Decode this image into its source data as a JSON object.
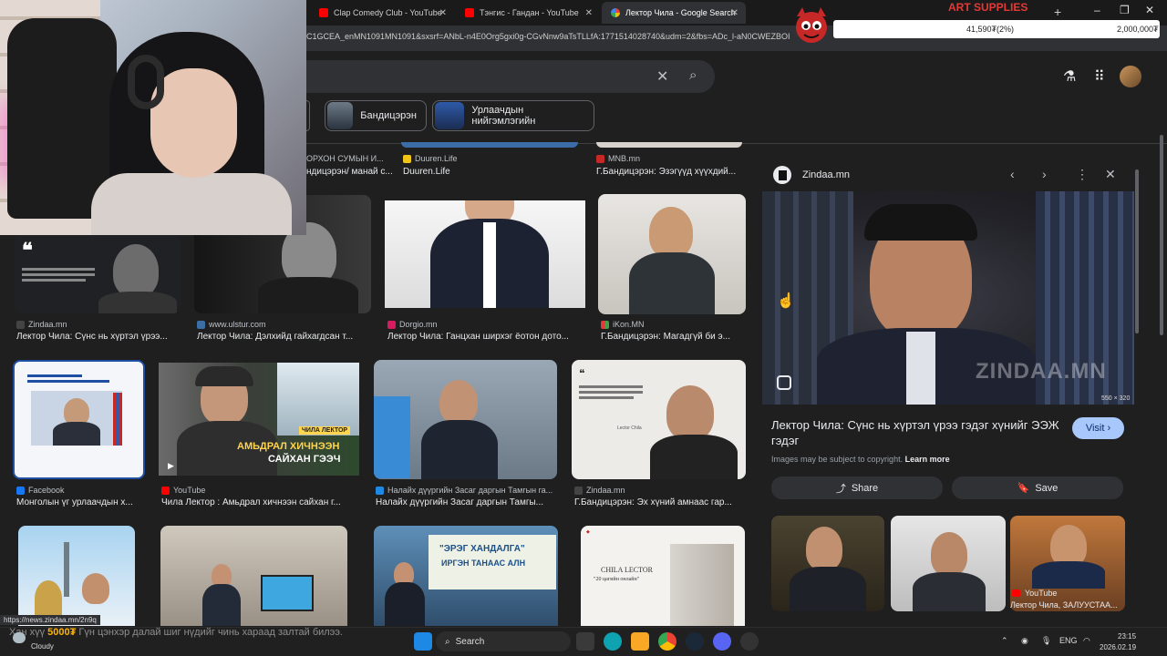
{
  "browser": {
    "tabs": [
      {
        "label": "Clap Comedy Club - YouTube",
        "icon": "youtube-icon",
        "active": false
      },
      {
        "label": "Тэнгис - Гандан - YouTube",
        "icon": "youtube-icon",
        "active": false
      },
      {
        "label": "Лектор Чила - Google Search",
        "icon": "google-icon",
        "active": true
      }
    ],
    "url": "C1GCEA_enMN1091MN1091&sxsrf=ANbL-n4E0Org5gxi0g-CGvNnw9aTsTLLfA:1771514028740&udm=2&fbs=ADc_l-aN0CWEZBOI"
  },
  "overlay": {
    "art_title": "ART SUPPLIES",
    "art_left": "41,590₮(2%)",
    "art_right": "2,000,000₮",
    "ticker_amount": "5000₮",
    "ticker_prefix": "Хан хүү",
    "ticker_text": "Гүн цэнхэр далай шиг нүдийг чинь хараад залтай билээ."
  },
  "search": {
    "chips": [
      {
        "label": "Бандицэрэн"
      },
      {
        "label": "Урлаачдын нийгэмлэгийн"
      }
    ]
  },
  "results": {
    "row0": [
      {
        "source": "ОРХОН СУМЫН И...",
        "title": "ндицэрэн/ манай с..."
      },
      {
        "source": "Duuren.Life",
        "title": "Duuren.Life"
      },
      {
        "source": "MNB.mn",
        "title": "Г.Бандицэрэн: Эзэгүүд хүүхдий..."
      }
    ],
    "row1": [
      {
        "source": "Zindaa.mn",
        "title": "Лектор Чила: Сүнс нь хүртэл үрээ..."
      },
      {
        "source": "www.ulstur.com",
        "title": "Лектор Чила: Дэлхийд гайхагдсан т..."
      },
      {
        "source": "Dorgio.mn",
        "title": "Лектор Чила: Ганцхан ширхэг ёотон дото..."
      },
      {
        "source": "iKon.MN",
        "title": "Г.Бандицэрэн: Магадгүй би э..."
      }
    ],
    "row2": [
      {
        "source": "Facebook",
        "title": "Монголын үг урлаачдын х..."
      },
      {
        "source": "YouTube",
        "title": "Чила Лектор : Амьдрал хичнээн сайхан г..."
      },
      {
        "source": "Налайх дүүргийн Засаг даргын Тамгын га...",
        "title": "Налайх дүүргийн Засаг даргын Тамгы..."
      },
      {
        "source": "Zindaa.mn",
        "title": "Г.Бандицэрэн: Эх хүний амнаас гар..."
      }
    ],
    "youtube_overlay": {
      "tag": "ЧИЛА ЛЕКТОР",
      "line1": "АМЬДРАЛ ХИЧНЭЭН",
      "line2": "САЙХАН ГЭЭЧ"
    },
    "banner": {
      "line1": "\"ЭРЭГ ХАНДАЛГА\"",
      "line2": "ИРГЭН ТАНААС АЛН"
    },
    "book": {
      "title": "CHILA LECTOR",
      "sub": "\"20 цагийн онлайн\""
    },
    "quote_caption": "Lector Chila"
  },
  "panel": {
    "site": "Zindaa.mn",
    "dimensions": "550 × 320",
    "watermark": "ZINDAA.MN",
    "title": "Лектор Чила: Сүнс нь хүртэл үрээ гэдэг хүнийг ЭЭЖ гэдэг",
    "visit_label": "Visit",
    "copyright": "Images may be subject to copyright.",
    "learn_more": "Learn more",
    "share_label": "Share",
    "save_label": "Save",
    "related_source": "YouTube",
    "related_title": "Лектор Чила, ЗАЛУУСТАА..."
  },
  "status_url": "https://news.zindaa.mn/2n9q",
  "taskbar": {
    "weather": "Cloudy",
    "search_label": "Search",
    "lang": "ENG",
    "time": "23:15",
    "date": "2026.02.19"
  }
}
